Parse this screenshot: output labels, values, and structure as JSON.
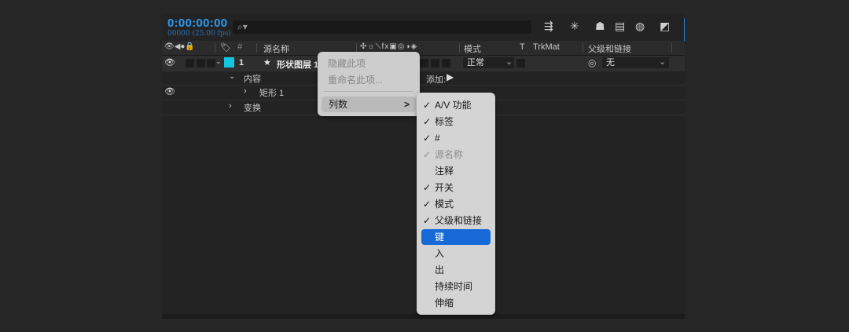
{
  "timecode": "0:00:00:00",
  "fps": "00000 (25.00 fps)",
  "search": {
    "placeholder": ""
  },
  "icons": {
    "search": "search-icon",
    "tools": [
      "flowchart-icon",
      "draft-3d-icon",
      "solo-icon",
      "frame-blend-icon",
      "motion-blur-icon",
      "graph-editor-icon"
    ]
  },
  "columns": {
    "source_name": "源名称",
    "mode": "模式",
    "t": "T",
    "trkmat": "TrkMat",
    "parent": "父级和链接"
  },
  "layer": {
    "number": "1",
    "name": "形状图层 1",
    "mode": "正常",
    "parent": "无",
    "label_color": "#11c7e0"
  },
  "tree": {
    "contents": "内容",
    "add_label": "添加:",
    "rect": "矩形 1",
    "transform": "变换"
  },
  "context_menu": {
    "hide": "隐藏此项",
    "rename": "重命名此项...",
    "columns": "列数",
    "arrow": ">"
  },
  "columns_menu": [
    {
      "label": "A/V 功能",
      "checked": true,
      "enabled": true,
      "highlighted": false
    },
    {
      "label": "标签",
      "checked": true,
      "enabled": true,
      "highlighted": false
    },
    {
      "label": "#",
      "checked": true,
      "enabled": true,
      "highlighted": false
    },
    {
      "label": "源名称",
      "checked": true,
      "enabled": false,
      "highlighted": false
    },
    {
      "label": "注释",
      "checked": false,
      "enabled": true,
      "highlighted": false
    },
    {
      "label": "开关",
      "checked": true,
      "enabled": true,
      "highlighted": false
    },
    {
      "label": "模式",
      "checked": true,
      "enabled": true,
      "highlighted": false
    },
    {
      "label": "父级和链接",
      "checked": true,
      "enabled": true,
      "highlighted": false
    },
    {
      "label": "键",
      "checked": false,
      "enabled": true,
      "highlighted": true
    },
    {
      "label": "入",
      "checked": false,
      "enabled": true,
      "highlighted": false
    },
    {
      "label": "出",
      "checked": false,
      "enabled": true,
      "highlighted": false
    },
    {
      "label": "持续时间",
      "checked": false,
      "enabled": true,
      "highlighted": false
    },
    {
      "label": "伸缩",
      "checked": false,
      "enabled": true,
      "highlighted": false
    }
  ],
  "check_glyph": "✓",
  "colors": {
    "accent": "#2d9af0",
    "highlight": "#1669d6",
    "panel": "#232323"
  }
}
